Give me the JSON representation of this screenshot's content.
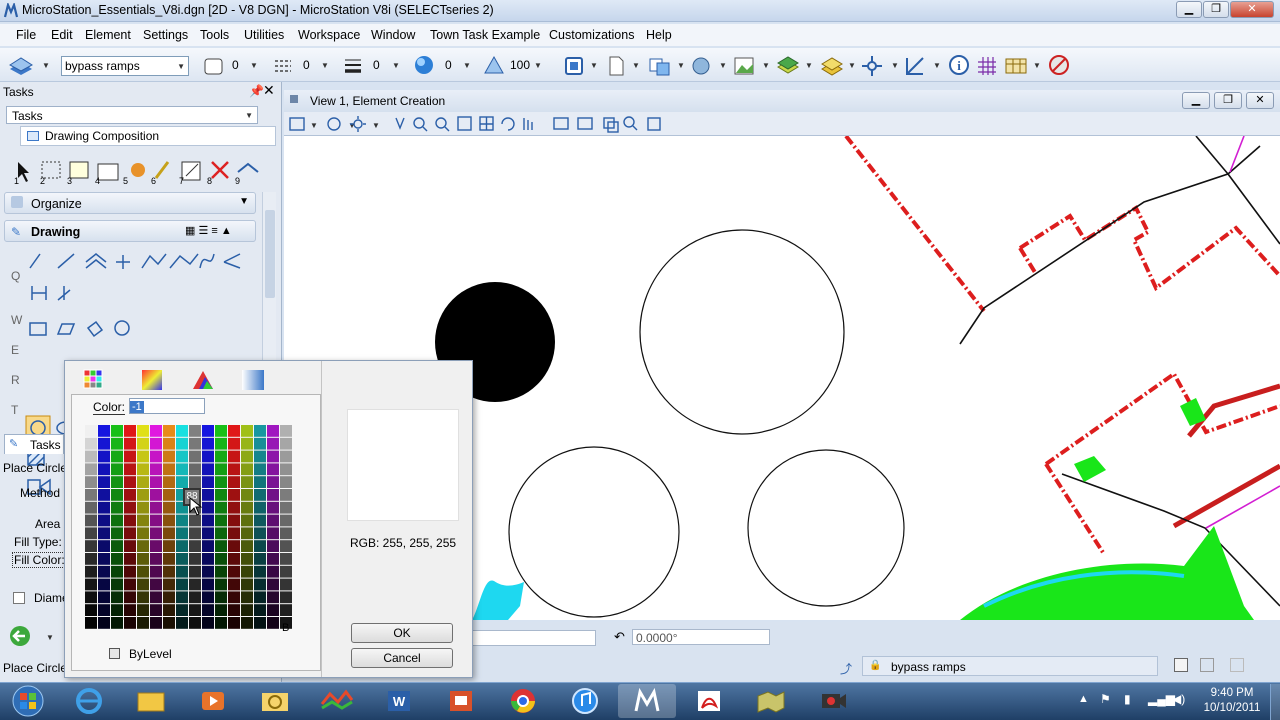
{
  "title": "MicroStation_Essentials_V8i.dgn [2D - V8 DGN] - MicroStation V8i (SELECTseries 2)",
  "menu": [
    "File",
    "Edit",
    "Element",
    "Settings",
    "Tools",
    "Utilities",
    "Workspace",
    "Window",
    "Town Task Example",
    "Customizations",
    "Help"
  ],
  "toolbar": {
    "level": "bypass ramps",
    "color_val": "0",
    "style_val": "0",
    "weight_val": "0",
    "transp_val": "0",
    "priority_val": "100"
  },
  "tasks": {
    "title": "Tasks",
    "tab": "Tasks",
    "composition": "Drawing Composition",
    "organize": "Organize",
    "drawing": "Drawing",
    "bottom_tab": "Tasks",
    "side_letters": [
      "Q",
      "W",
      "E",
      "R",
      "T"
    ],
    "tool_numbers": [
      "1",
      "2",
      "3",
      "4",
      "5",
      "6",
      "7",
      "8",
      "9"
    ]
  },
  "tool_settings": {
    "title": "Place Circle",
    "method": "Method",
    "area": "Area",
    "fill_type": "Fill Type:",
    "fill_color": "Fill Color:",
    "diameter": "Diame"
  },
  "status_left": "Place Circle",
  "view": {
    "title": "View 1, Element Creation"
  },
  "dialog": {
    "color_label": "Color:",
    "color_value": "-1",
    "cell_tip": "88",
    "b_label": "B",
    "bylevel": "ByLevel",
    "rgb": "RGB: 255, 255, 255",
    "ok": "OK",
    "cancel": "Cancel"
  },
  "status": {
    "angle": "0.0000°",
    "level": "bypass ramps"
  },
  "clock": {
    "time": "9:40 PM",
    "date": "10/10/2011"
  },
  "colors": {
    "red_dashed": "#dd1e1e",
    "green_fill": "#19e619",
    "cyan_fill": "#1ed8f0",
    "magenta": "#d21ed2",
    "accent": "#3c78c8"
  }
}
